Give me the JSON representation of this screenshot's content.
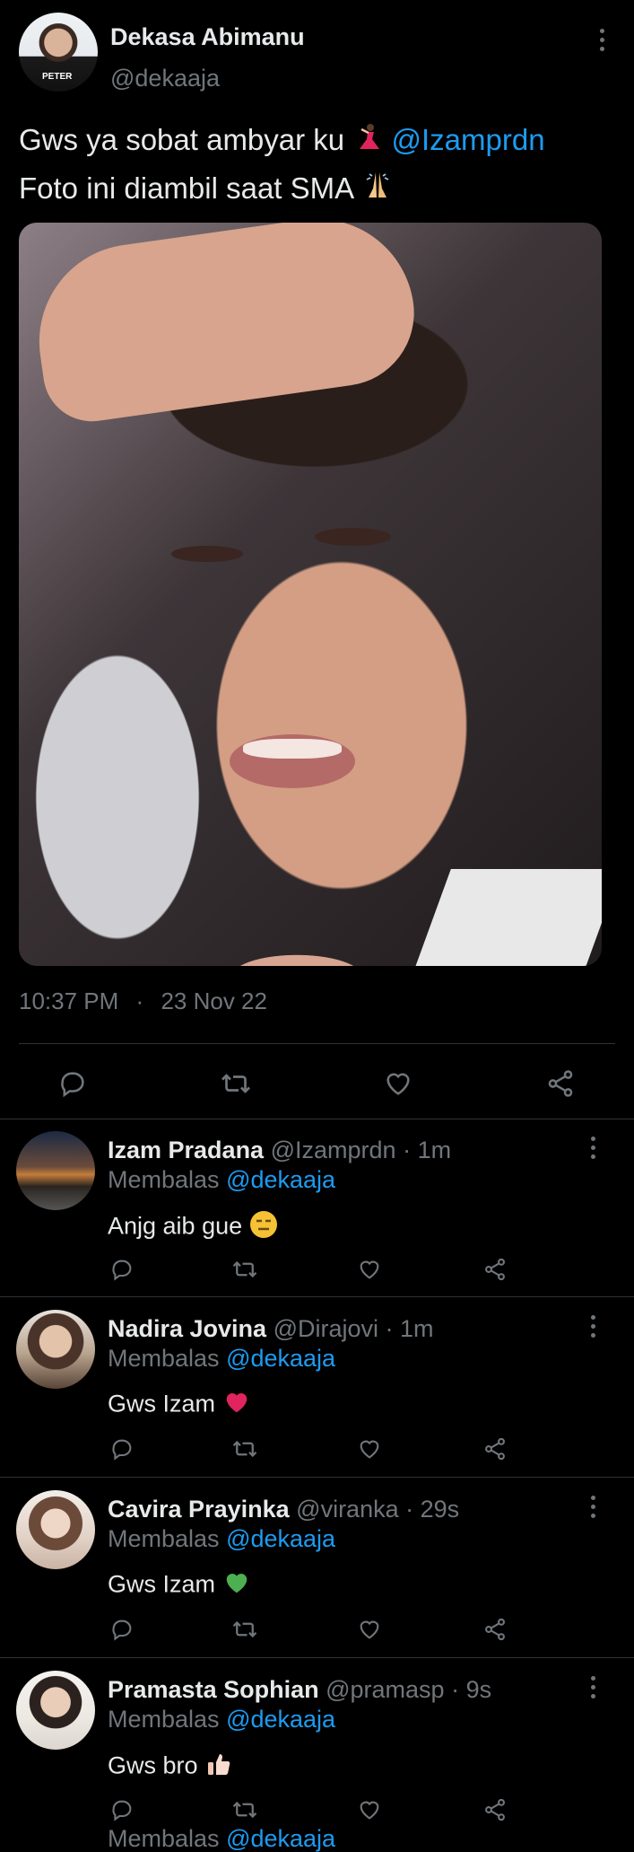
{
  "tweet": {
    "author_name": "Dekasa Abimanu",
    "author_handle": "@dekaaja",
    "avatar_shirt_text": "PETER",
    "text_line1": "Gws ya sobat ambyar ku",
    "text_mention": "@Izamprdn",
    "text_line2": "Foto ini diambil saat SMA",
    "time": "10:37 PM",
    "separator": "·",
    "date": "23 Nov 22"
  },
  "replies": [
    {
      "name": "Izam Pradana",
      "handle": "@Izamprdn",
      "age": "1m",
      "replying_label": "Membalas",
      "replying_to": "@dekaaja",
      "text": "Anjg aib gue",
      "emoji": "expressionless-face",
      "avatar_color": "#c47c3a"
    },
    {
      "name": "Nadira Jovina",
      "handle": "@Dirajovi",
      "age": "1m",
      "replying_label": "Membalas",
      "replying_to": "@dekaaja",
      "text": "Gws Izam",
      "emoji": "red-heart",
      "avatar_color": "#8b6a57"
    },
    {
      "name": "Cavira Prayinka",
      "handle": "@viranka",
      "age": "29s",
      "replying_label": "Membalas",
      "replying_to": "@dekaaja",
      "text": "Gws Izam",
      "emoji": "green-heart",
      "avatar_color": "#d9c4b8"
    },
    {
      "name": "Pramasta Sophian",
      "handle": "@pramasp",
      "age": "9s",
      "replying_label": "Membalas",
      "replying_to": "@dekaaja",
      "text": "Gws bro",
      "emoji": "thumbs-up",
      "avatar_color": "#eae6e0"
    }
  ],
  "partial_row": {
    "replying_label": "Membalas",
    "replying_to": "@dekaaja"
  },
  "colors": {
    "background": "#000000",
    "text": "#e7e9ea",
    "muted": "#71767b",
    "link": "#1d9bf0",
    "divider": "#2f3336",
    "red_heart": "#e0245e",
    "green_heart": "#4caf50"
  }
}
